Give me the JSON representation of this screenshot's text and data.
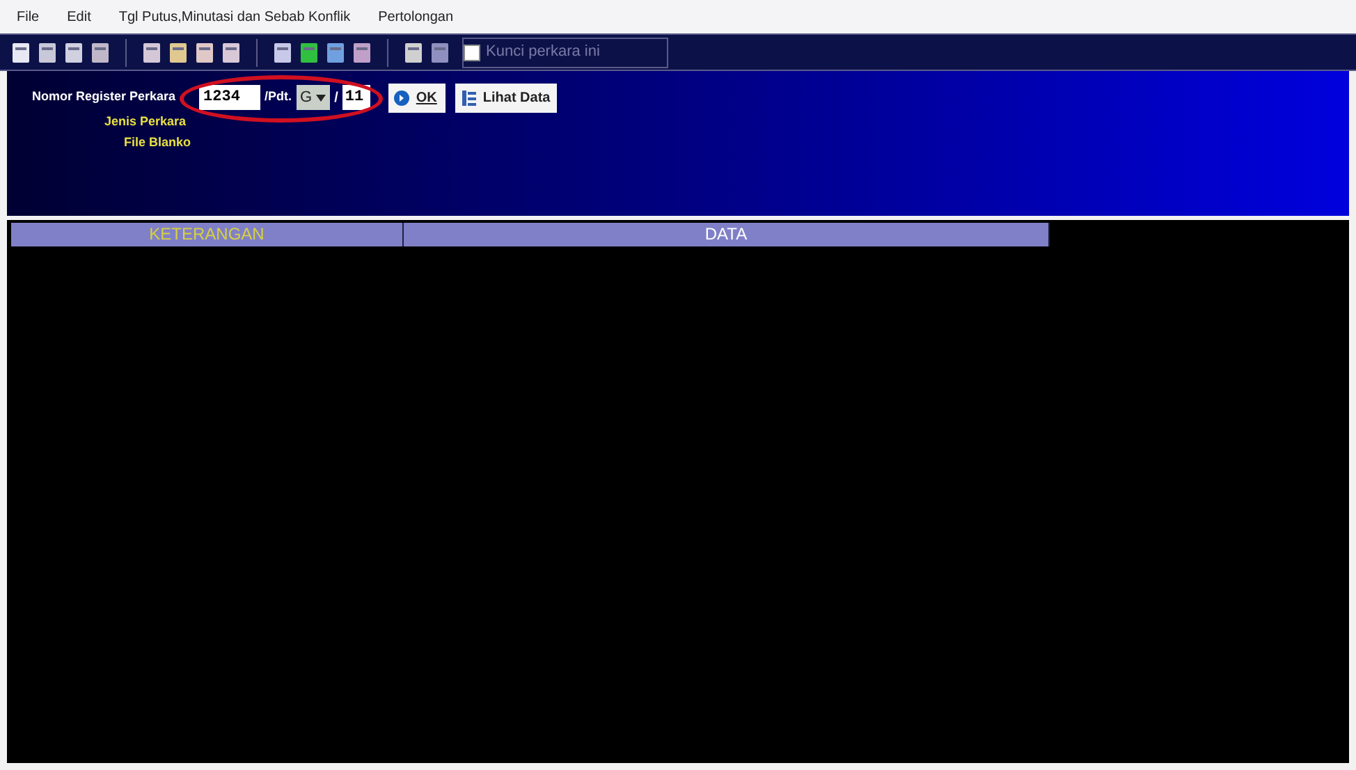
{
  "menu": [
    "File",
    "Edit",
    "Tgl Putus,Minutasi dan Sebab Konflik",
    "Pertolongan"
  ],
  "toolbar": {
    "lock_checkbox": {
      "label": "Kunci perkara ini",
      "checked": false
    }
  },
  "form": {
    "label": "Nomor Register Perkara",
    "number": "1234",
    "separator_1": "/Pdt.",
    "type": "G",
    "separator_2": "/",
    "year": "11",
    "ok_button": "OK",
    "view_button": "Lihat Data",
    "fields": [
      "Jenis Perkara",
      "File Blanko"
    ]
  },
  "table": {
    "columns": [
      "KETERANGAN",
      "DATA"
    ]
  }
}
